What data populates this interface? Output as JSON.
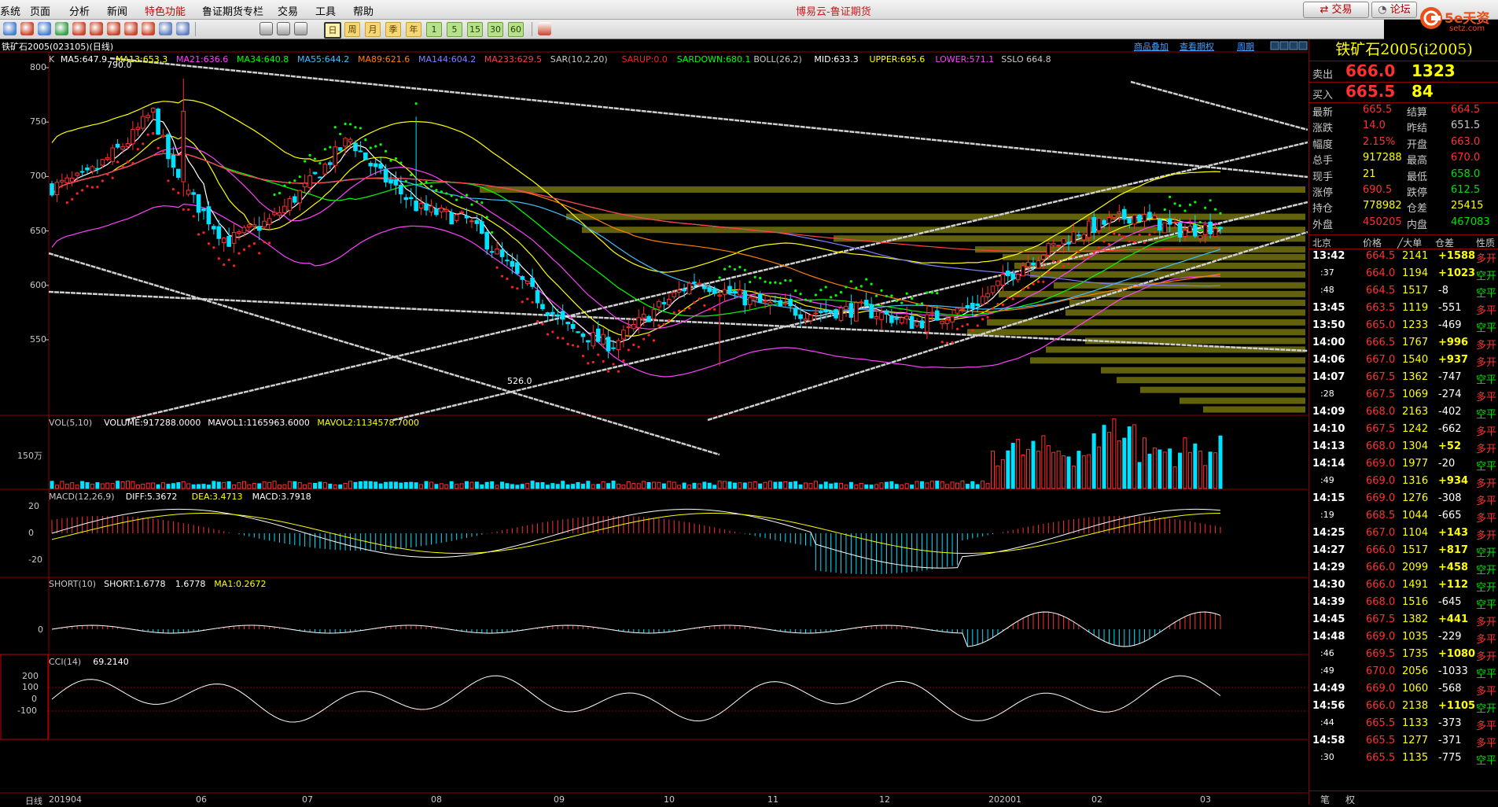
{
  "menu": {
    "items": [
      "系统",
      "页面",
      "分析",
      "新闻",
      "特色功能",
      "鲁证期货专栏",
      "交易",
      "工具",
      "帮助"
    ],
    "app_title": "博易云-鲁证期货",
    "trade_btn": "交易",
    "forum_btn": "论坛",
    "logo_text": "5e天资",
    "logo_sub": "setz.com"
  },
  "toolbar": {
    "periods": [
      "1",
      "5",
      "15",
      "30",
      "60",
      "日",
      "周",
      "月",
      "季",
      "年"
    ],
    "selected": "日"
  },
  "chart": {
    "header": "铁矿石2005(023105)(日线)",
    "links": [
      "商品叠加",
      "查看期权",
      "周期"
    ],
    "ma_line": [
      {
        "text": "K",
        "color": "#c8c8c8"
      },
      {
        "text": "MA5:647.9",
        "color": "#ffffff"
      },
      {
        "text": "MA13:653.3",
        "color": "#ffff00"
      },
      {
        "text": "MA21:636.6",
        "color": "#ff40ff"
      },
      {
        "text": "MA34:640.8",
        "color": "#00ff00"
      },
      {
        "text": "MA55:644.2",
        "color": "#40c0ff"
      },
      {
        "text": "MA89:621.6",
        "color": "#ff8000"
      },
      {
        "text": "MA144:604.2",
        "color": "#8080ff"
      },
      {
        "text": "MA233:629.5",
        "color": "#ff4040"
      },
      {
        "text": "SAR(10,2,20)",
        "color": "#c8c8c8"
      },
      {
        "text": "SARUP:0.0",
        "color": "#ff2020"
      },
      {
        "text": "SARDOWN:680.1",
        "color": "#00ff00"
      },
      {
        "text": "BOLL(26,2)",
        "color": "#c8c8c8"
      },
      {
        "text": "MID:633.3",
        "color": "#ffffff"
      },
      {
        "text": "UPPER:695.6",
        "color": "#ffff00"
      },
      {
        "text": "LOWER:571.1",
        "color": "#ff40ff"
      },
      {
        "text": "SSLO 664.8",
        "color": "#c8c8c8"
      }
    ],
    "price_ticks": [
      "800",
      "750",
      "700",
      "650",
      "600",
      "550"
    ],
    "high_mark": "790.0",
    "low_mark": "526.0",
    "vol_header": [
      {
        "text": "VOL(5,10)",
        "color": "#c8c8c8"
      },
      {
        "text": "VOLUME:917288.0000",
        "color": "#ffffff"
      },
      {
        "text": "MAVOL1:1165963.6000",
        "color": "#ffffff"
      },
      {
        "text": "MAVOL2:1134578.7000",
        "color": "#ffff00"
      }
    ],
    "vol_tick": "150万",
    "macd_header": [
      {
        "text": "MACD(12,26,9)",
        "color": "#c8c8c8"
      },
      {
        "text": "DIFF:5.3672",
        "color": "#ffffff"
      },
      {
        "text": "DEA:3.4713",
        "color": "#ffff00"
      },
      {
        "text": "MACD:3.7918",
        "color": "#ffffff"
      }
    ],
    "macd_ticks": [
      "20",
      "0",
      "-20"
    ],
    "short_header": [
      {
        "text": "SHORT(10)",
        "color": "#c8c8c8"
      },
      {
        "text": "SHORT:1.6778",
        "color": "#ffffff"
      },
      {
        "text": "1.6778",
        "color": "#ffffff"
      },
      {
        "text": "MA1:0.2672",
        "color": "#ffff00"
      }
    ],
    "short_tick": "0",
    "cci_header": [
      {
        "text": "CCI(14)",
        "color": "#c8c8c8"
      },
      {
        "text": "69.2140",
        "color": "#ffffff"
      }
    ],
    "cci_ticks": [
      "200",
      "100",
      "0",
      "-100"
    ],
    "period_label": "日线",
    "dates": [
      "201904",
      "06",
      "07",
      "08",
      "09",
      "10",
      "11",
      "12",
      "202001",
      "02",
      "03"
    ]
  },
  "panel": {
    "title": "铁矿石2005(i2005)",
    "sell": {
      "label": "卖出",
      "price": "666.0",
      "vol": "1323"
    },
    "buy": {
      "label": "买入",
      "price": "665.5",
      "vol": "84"
    },
    "stats": [
      [
        "最新",
        "665.5",
        "结算",
        "664.5"
      ],
      [
        "涨跌",
        "14.0",
        "昨结",
        "651.5"
      ],
      [
        "幅度",
        "2.15%",
        "开盘",
        "663.0"
      ],
      [
        "总手",
        "917288",
        "最高",
        "670.0"
      ],
      [
        "现手",
        "21",
        "最低",
        "658.0"
      ],
      [
        "涨停",
        "690.5",
        "跌停",
        "612.5"
      ],
      [
        "持仓",
        "778982",
        "仓差",
        "25415"
      ],
      [
        "外盘",
        "450205",
        "内盘",
        "467083"
      ]
    ],
    "tick_header": [
      "北京",
      "价格",
      "╱大单",
      "仓差",
      "性质"
    ],
    "ticks": [
      [
        "13:42",
        "664.5",
        "2141",
        "+1588",
        "多开"
      ],
      [
        ":37",
        "664.0",
        "1194",
        "+1023",
        "空开"
      ],
      [
        ":48",
        "664.5",
        "1517",
        "-8",
        "空平"
      ],
      [
        "13:45",
        "663.5",
        "1119",
        "-551",
        "多平"
      ],
      [
        "13:50",
        "665.0",
        "1233",
        "-469",
        "空平"
      ],
      [
        "14:00",
        "666.5",
        "1767",
        "+996",
        "多开"
      ],
      [
        "14:06",
        "667.0",
        "1540",
        "+937",
        "多开"
      ],
      [
        "14:07",
        "667.5",
        "1362",
        "-747",
        "空平"
      ],
      [
        ":28",
        "667.5",
        "1069",
        "-274",
        "多平"
      ],
      [
        "14:09",
        "668.0",
        "2163",
        "-402",
        "空平"
      ],
      [
        "14:10",
        "667.5",
        "1242",
        "-662",
        "多平"
      ],
      [
        "14:13",
        "668.0",
        "1304",
        "+52",
        "多开"
      ],
      [
        "14:14",
        "669.0",
        "1977",
        "-20",
        "空平"
      ],
      [
        ":49",
        "669.0",
        "1316",
        "+934",
        "多开"
      ],
      [
        "14:15",
        "669.0",
        "1276",
        "-308",
        "多平"
      ],
      [
        ":19",
        "668.5",
        "1044",
        "-665",
        "多平"
      ],
      [
        "14:25",
        "667.0",
        "1104",
        "+143",
        "多开"
      ],
      [
        "14:27",
        "666.0",
        "1517",
        "+817",
        "空开"
      ],
      [
        "14:29",
        "666.0",
        "2099",
        "+458",
        "空开"
      ],
      [
        "14:30",
        "666.0",
        "1491",
        "+112",
        "空开"
      ],
      [
        "14:39",
        "668.0",
        "1516",
        "-645",
        "空平"
      ],
      [
        "14:45",
        "667.5",
        "1382",
        "+441",
        "多开"
      ],
      [
        "14:48",
        "669.0",
        "1035",
        "-229",
        "多平"
      ],
      [
        ":46",
        "669.5",
        "1735",
        "+1080",
        "多开"
      ],
      [
        ":49",
        "670.0",
        "2056",
        "-1033",
        "空平"
      ],
      [
        "14:49",
        "669.0",
        "1060",
        "-568",
        "多平"
      ],
      [
        "14:56",
        "666.0",
        "2138",
        "+1105",
        "空开"
      ],
      [
        ":44",
        "665.5",
        "1133",
        "-373",
        "多平"
      ],
      [
        "14:58",
        "665.5",
        "1277",
        "-371",
        "多平"
      ],
      [
        ":30",
        "665.5",
        "1135",
        "-775",
        "空平"
      ]
    ],
    "bottom_tabs": [
      "笔",
      "权"
    ]
  }
}
